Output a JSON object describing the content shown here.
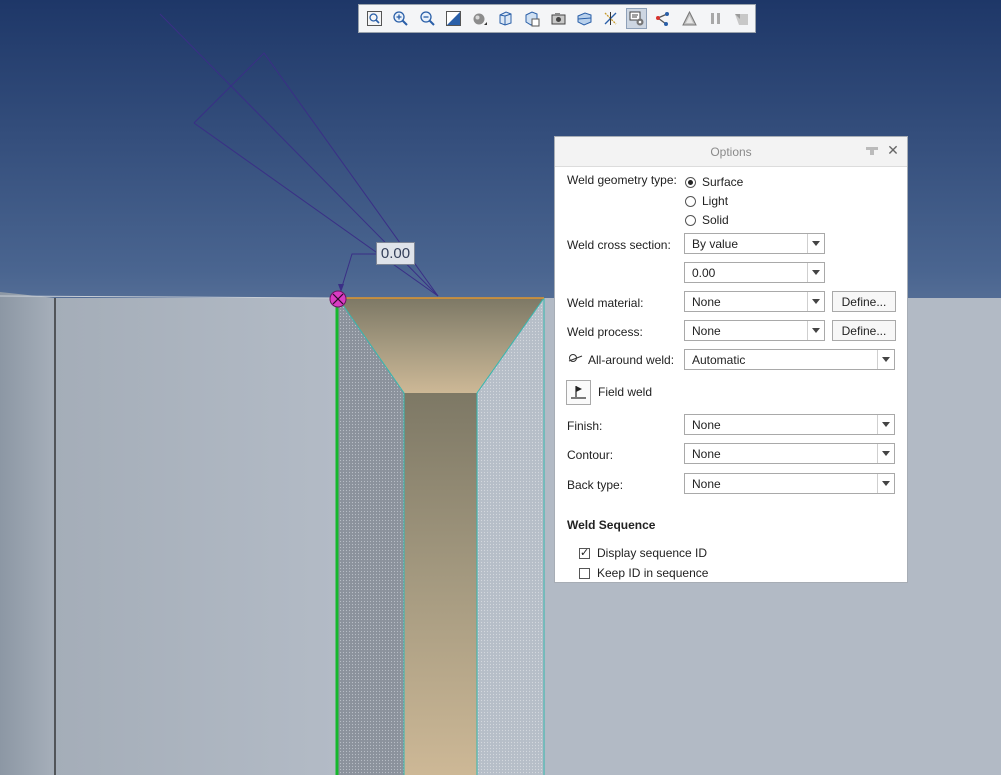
{
  "viewport": {
    "dimension_value": "0.00"
  },
  "toolbar": {
    "buttons": [
      {
        "icon": "zoom-fit-icon"
      },
      {
        "icon": "zoom-in-icon"
      },
      {
        "icon": "zoom-out-icon"
      },
      {
        "icon": "repaint-icon"
      },
      {
        "icon": "display-style-icon"
      },
      {
        "icon": "saved-orientations-icon"
      },
      {
        "icon": "view-manager-icon"
      },
      {
        "icon": "perspective-view-icon"
      },
      {
        "icon": "section-icon"
      },
      {
        "icon": "datum-display-icon"
      },
      {
        "icon": "annotation-display-icon",
        "active": true
      },
      {
        "icon": "spin-center-icon"
      },
      {
        "icon": "appearance-icon"
      },
      {
        "icon": "pause-icon"
      },
      {
        "icon": "annotation-orientation-icon"
      }
    ]
  },
  "options_panel": {
    "title": "Options",
    "geometry": {
      "label": "Weld geometry type:",
      "options": [
        "Surface",
        "Light",
        "Solid"
      ],
      "selected": "Surface"
    },
    "cross_section": {
      "label": "Weld cross section:",
      "value": "By value",
      "size_value": "0.00"
    },
    "material": {
      "label": "Weld material:",
      "value": "None",
      "define": "Define..."
    },
    "process": {
      "label": "Weld process:",
      "value": "None",
      "define": "Define..."
    },
    "all_around": {
      "label": "All-around weld:",
      "value": "Automatic"
    },
    "field_weld": {
      "label": "Field weld"
    },
    "finish": {
      "label": "Finish:",
      "value": "None"
    },
    "contour": {
      "label": "Contour:",
      "value": "None"
    },
    "back_type": {
      "label": "Back type:",
      "value": "None"
    },
    "sequence": {
      "title": "Weld Sequence",
      "display_id": {
        "label": "Display sequence ID",
        "checked": true
      },
      "keep_id": {
        "label": "Keep ID in sequence",
        "checked": false
      }
    }
  }
}
